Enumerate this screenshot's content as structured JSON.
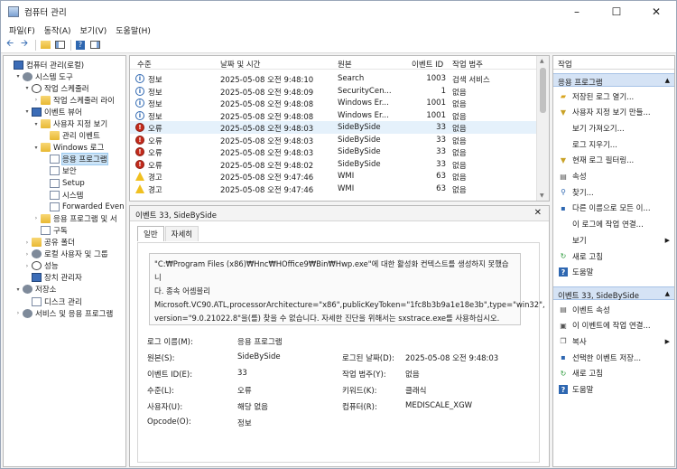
{
  "window": {
    "title": "컴퓨터 관리"
  },
  "menu": [
    "파일(F)",
    "동작(A)",
    "보기(V)",
    "도움말(H)"
  ],
  "tree": [
    {
      "label": "컴퓨터 관리(로컬)",
      "depth": 0,
      "exp": "",
      "icon": "computer-icon"
    },
    {
      "label": "시스템 도구",
      "depth": 1,
      "exp": "▾",
      "icon": "tools-icon"
    },
    {
      "label": "작업 스케줄러",
      "depth": 2,
      "exp": "▾",
      "icon": "clock-icon"
    },
    {
      "label": "작업 스케줄러 라이",
      "depth": 3,
      "exp": "›",
      "icon": "folder-icon"
    },
    {
      "label": "이벤트 뷰어",
      "depth": 2,
      "exp": "▾",
      "icon": "event-viewer-icon"
    },
    {
      "label": "사용자 지정 보기",
      "depth": 3,
      "exp": "▾",
      "icon": "folder-icon"
    },
    {
      "label": "관리 이벤트",
      "depth": 4,
      "exp": "",
      "icon": "filter-icon"
    },
    {
      "label": "Windows 로그",
      "depth": 3,
      "exp": "▾",
      "icon": "folder-icon"
    },
    {
      "label": "응용 프로그램",
      "depth": 4,
      "exp": "",
      "icon": "log-icon",
      "selected": true
    },
    {
      "label": "보안",
      "depth": 4,
      "exp": "",
      "icon": "log-icon"
    },
    {
      "label": "Setup",
      "depth": 4,
      "exp": "",
      "icon": "log-icon"
    },
    {
      "label": "시스템",
      "depth": 4,
      "exp": "",
      "icon": "log-icon"
    },
    {
      "label": "Forwarded Even",
      "depth": 4,
      "exp": "",
      "icon": "log-icon"
    },
    {
      "label": "응용 프로그램 및 서",
      "depth": 3,
      "exp": "›",
      "icon": "folder-icon"
    },
    {
      "label": "구독",
      "depth": 3,
      "exp": "",
      "icon": "subscription-icon"
    },
    {
      "label": "공유 폴더",
      "depth": 2,
      "exp": "›",
      "icon": "shared-folder-icon"
    },
    {
      "label": "로컬 사용자 및 그룹",
      "depth": 2,
      "exp": "›",
      "icon": "users-icon"
    },
    {
      "label": "성능",
      "depth": 2,
      "exp": "›",
      "icon": "performance-icon"
    },
    {
      "label": "장치 관리자",
      "depth": 2,
      "exp": "",
      "icon": "device-manager-icon"
    },
    {
      "label": "저장소",
      "depth": 1,
      "exp": "▾",
      "icon": "storage-icon"
    },
    {
      "label": "디스크 관리",
      "depth": 2,
      "exp": "",
      "icon": "disk-icon"
    },
    {
      "label": "서비스 및 응용 프로그램",
      "depth": 1,
      "exp": "›",
      "icon": "services-icon"
    }
  ],
  "list": {
    "columns": [
      "수준",
      "날짜 및 시간",
      "원본",
      "이벤트 ID",
      "작업 범주"
    ],
    "rows": [
      {
        "level": "정보",
        "kind": "info",
        "date": "2025-05-08 오전 9:48:10",
        "source": "Search",
        "id": "1003",
        "cat": "검색 서비스"
      },
      {
        "level": "정보",
        "kind": "info",
        "date": "2025-05-08 오전 9:48:09",
        "source": "SecurityCen...",
        "id": "1",
        "cat": "없음"
      },
      {
        "level": "정보",
        "kind": "info",
        "date": "2025-05-08 오전 9:48:08",
        "source": "Windows Er...",
        "id": "1001",
        "cat": "없음"
      },
      {
        "level": "정보",
        "kind": "info",
        "date": "2025-05-08 오전 9:48:08",
        "source": "Windows Er...",
        "id": "1001",
        "cat": "없음"
      },
      {
        "level": "오류",
        "kind": "error",
        "date": "2025-05-08 오전 9:48:03",
        "source": "SideBySide",
        "id": "33",
        "cat": "없음",
        "selected": true
      },
      {
        "level": "오류",
        "kind": "error",
        "date": "2025-05-08 오전 9:48:03",
        "source": "SideBySide",
        "id": "33",
        "cat": "없음"
      },
      {
        "level": "오류",
        "kind": "error",
        "date": "2025-05-08 오전 9:48:03",
        "source": "SideBySide",
        "id": "33",
        "cat": "없음"
      },
      {
        "level": "오류",
        "kind": "error",
        "date": "2025-05-08 오전 9:48:02",
        "source": "SideBySide",
        "id": "33",
        "cat": "없음"
      },
      {
        "level": "경고",
        "kind": "warning",
        "date": "2025-05-08 오전 9:47:46",
        "source": "WMI",
        "id": "63",
        "cat": "없음"
      },
      {
        "level": "경고",
        "kind": "warning",
        "date": "2025-05-08 오전 9:47:46",
        "source": "WMI",
        "id": "63",
        "cat": "없음"
      }
    ]
  },
  "detail": {
    "title": "이벤트 33, SideBySide",
    "tabs": [
      "일반",
      "자세히"
    ],
    "message": [
      "\"C:₩Program Files (x86)₩Hnc₩HOffice9₩Bin₩Hwp.exe\"에 대한 활성화 컨텍스트를 생성하지 못했습니",
      "다. 종속 어셈블리",
      "Microsoft.VC90.ATL,processorArchitecture=\"x86\",publicKeyToken=\"1fc8b3b9a1e18e3b\",type=\"win32\",",
      "version=\"9.0.21022.8\"을(를) 찾을 수 없습니다. 자세한 진단을 위해서는 sxstrace.exe를 사용하십시오."
    ],
    "props": {
      "log_name_label": "로그 이름(M):",
      "log_name": "응용 프로그램",
      "source_label": "원본(S):",
      "source": "SideBySide",
      "logged_label": "로그된 날짜(D):",
      "logged": "2025-05-08 오전 9:48:03",
      "event_id_label": "이벤트 ID(E):",
      "event_id": "33",
      "category_label": "작업 범주(Y):",
      "category": "없음",
      "level_label": "수준(L):",
      "level": "오류",
      "keywords_label": "키워드(K):",
      "keywords": "클래식",
      "user_label": "사용자(U):",
      "user": "해당 없음",
      "computer_label": "컴퓨터(R):",
      "computer": "MEDISCALE_XGW",
      "opcode_label": "Opcode(O):",
      "opcode": "정보"
    }
  },
  "actions": {
    "header": "작업",
    "section1": "응용 프로그램",
    "items1": [
      {
        "label": "저장된 로그 열기...",
        "icon": "open-folder-icon"
      },
      {
        "label": "사용자 지정 보기 만들...",
        "icon": "filter-icon"
      },
      {
        "label": "보기 가져오기...",
        "icon": ""
      },
      {
        "label": "로그 지우기...",
        "icon": ""
      },
      {
        "label": "현재 로그 필터링...",
        "icon": "filter-icon"
      },
      {
        "label": "속성",
        "icon": "properties-icon"
      },
      {
        "label": "찾기...",
        "icon": "find-icon"
      },
      {
        "label": "다른 이름으로 모든 이...",
        "icon": "save-icon"
      },
      {
        "label": "이 로그에 작업 연결...",
        "icon": ""
      },
      {
        "label": "보기",
        "icon": "",
        "submenu": true
      },
      {
        "label": "새로 고침",
        "icon": "refresh-icon"
      },
      {
        "label": "도움말",
        "icon": "help-icon"
      }
    ],
    "section2": "이벤트 33, SideBySide",
    "items2": [
      {
        "label": "이벤트 속성",
        "icon": "properties-icon"
      },
      {
        "label": "이 이벤트에 작업 연결...",
        "icon": "task-icon"
      },
      {
        "label": "복사",
        "icon": "copy-icon",
        "submenu": true
      },
      {
        "label": "선택한 이벤트 저장...",
        "icon": "save-icon"
      },
      {
        "label": "새로 고침",
        "icon": "refresh-icon"
      },
      {
        "label": "도움말",
        "icon": "help-icon"
      }
    ]
  }
}
